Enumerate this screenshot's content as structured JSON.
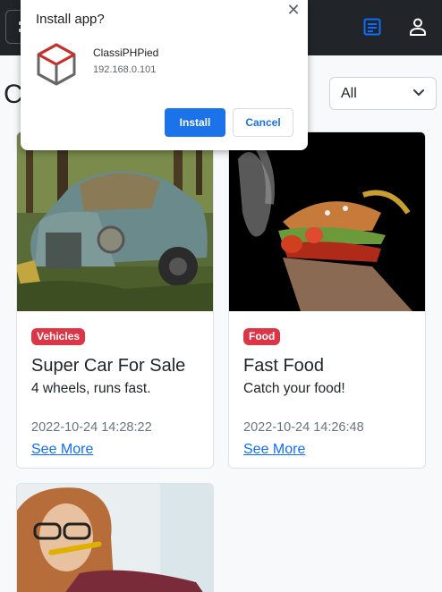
{
  "navbar": {
    "toggler_icon": "menu-icon",
    "notes_icon": "notes-icon",
    "user_icon": "user-icon"
  },
  "header": {
    "title_fragment": "C",
    "filter": {
      "selected": "All",
      "icon": "chevron-down-icon"
    }
  },
  "install_popup": {
    "title": "Install app?",
    "app_name": "ClassiPHPied",
    "origin": "192.168.0.101",
    "install_label": "Install",
    "cancel_label": "Cancel",
    "close_icon": "close-icon",
    "install_color": "#1a73e8"
  },
  "listings": [
    {
      "category": "Vehicles",
      "title": "Super Car For Sale",
      "description": "4 wheels, runs fast.",
      "date": "2022-10-24 14:28:22",
      "link_label": "See More",
      "image": "old-rusty-car-in-forest"
    },
    {
      "category": "Food",
      "title": "Fast Food",
      "description": "Catch your food!",
      "date": "2022-10-24 14:26:48",
      "link_label": "See More",
      "image": "flying-burger-on-black"
    },
    {
      "image": "woman-with-glasses-eating"
    }
  ],
  "colors": {
    "navbar_bg": "#212529",
    "badge_bg": "#dc3545",
    "link": "#0d6efd",
    "accent_icon": "#0d6efd"
  }
}
